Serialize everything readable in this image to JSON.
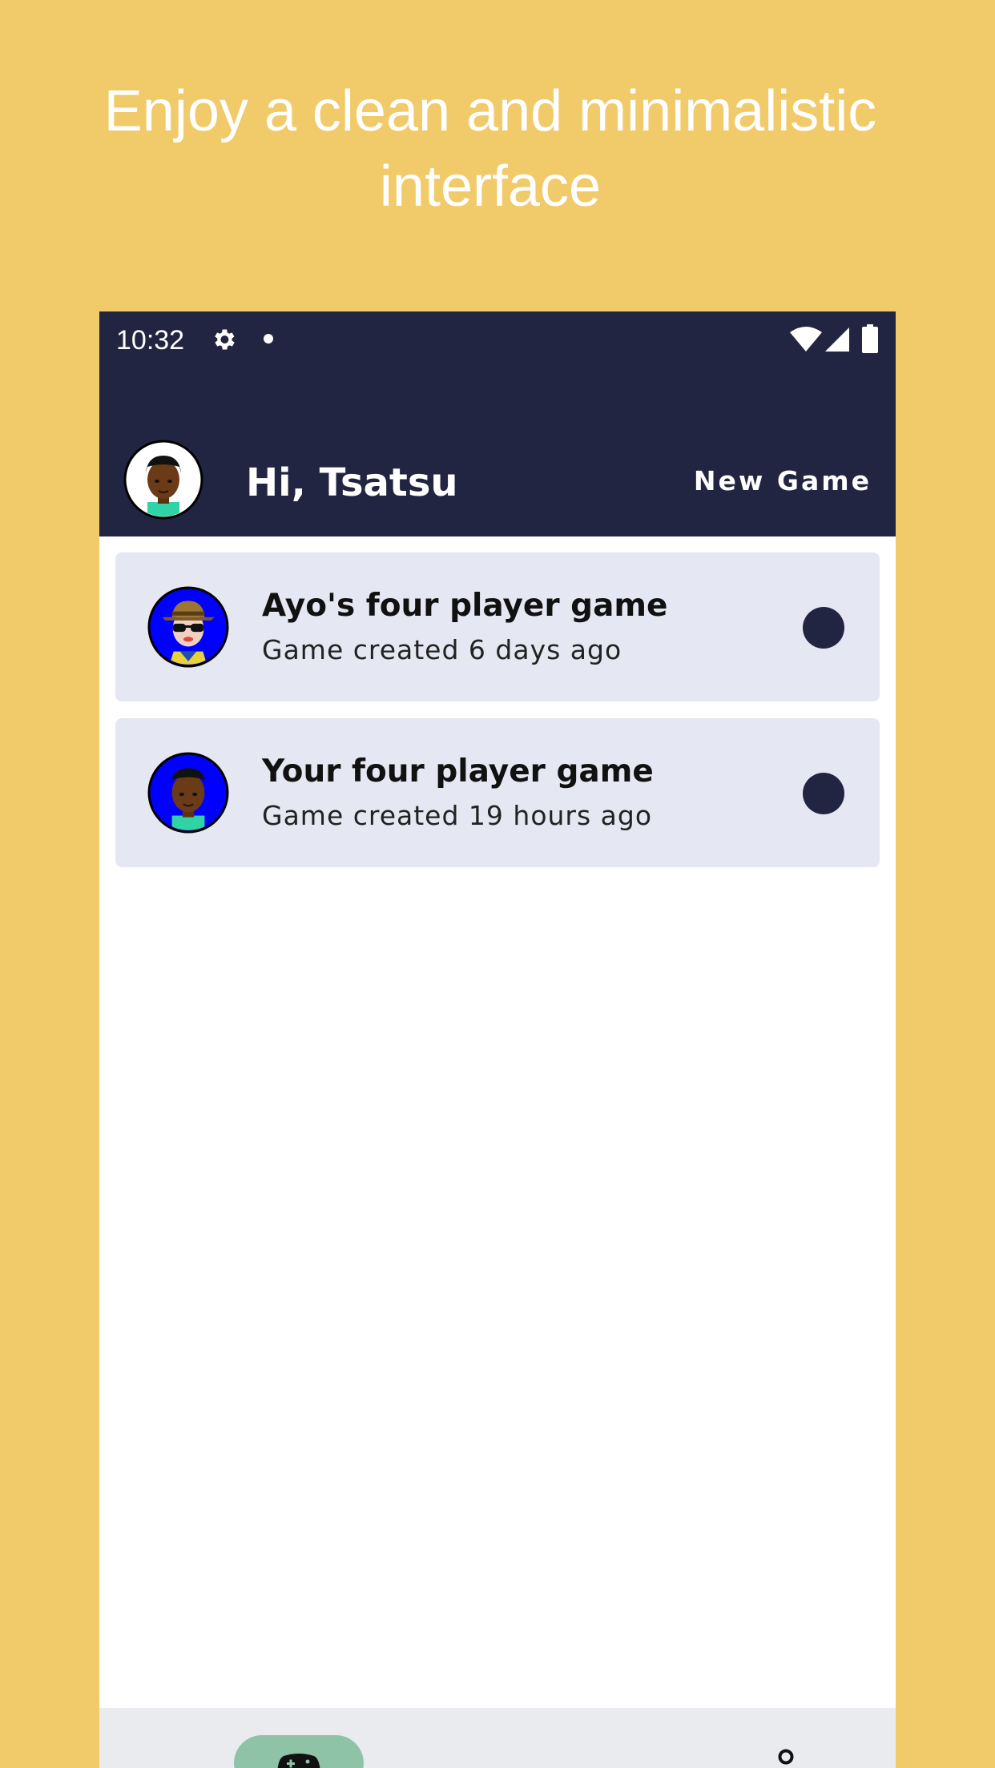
{
  "promo": {
    "headline": "Enjoy a clean and minimalistic interface"
  },
  "status_bar": {
    "time": "10:32",
    "icons": [
      "gear-icon",
      "notification-dot-icon",
      "wifi-icon",
      "signal-icon",
      "battery-icon"
    ]
  },
  "app_bar": {
    "greeting": "Hi, Tsatsu",
    "new_game_label": "New Game",
    "background": "#212542"
  },
  "games": [
    {
      "title": "Ayo's four player game",
      "subtitle": "Game created 6 days ago",
      "avatar": "avatar-sunglasses-hat"
    },
    {
      "title": "Your four player game",
      "subtitle": "Game created 19 hours ago",
      "avatar": "avatar-boy"
    }
  ],
  "bottom_nav": {
    "items": [
      "gamepad-icon",
      "profile-icon"
    ],
    "active_color": "#8FC3A8"
  },
  "colors": {
    "page_background": "#F1CA6A",
    "card_background": "#E5E7F2",
    "primary_dark": "#212542"
  }
}
